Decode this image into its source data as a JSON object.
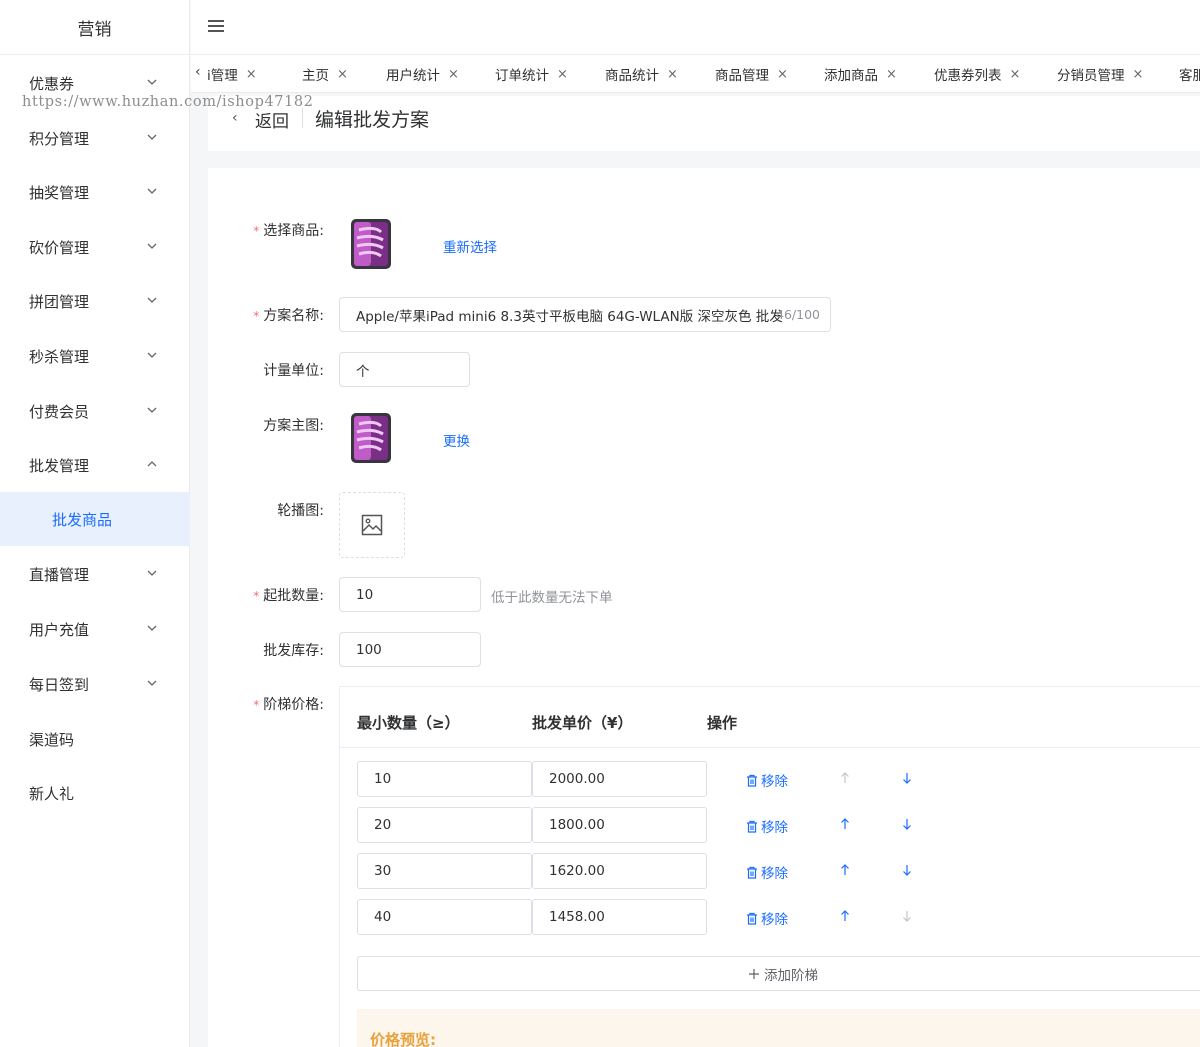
{
  "sidebar": {
    "brand": "营销",
    "items": [
      {
        "label": "优惠券",
        "chevron": "down"
      },
      {
        "label": "积分管理",
        "chevron": "down"
      },
      {
        "label": "抽奖管理",
        "chevron": "down"
      },
      {
        "label": "砍价管理",
        "chevron": "down"
      },
      {
        "label": "拼团管理",
        "chevron": "down"
      },
      {
        "label": "秒杀管理",
        "chevron": "down"
      },
      {
        "label": "付费会员",
        "chevron": "down"
      },
      {
        "label": "批发管理",
        "chevron": "up"
      },
      {
        "label": "批发商品",
        "active": true
      },
      {
        "label": "直播管理",
        "chevron": "down"
      },
      {
        "label": "用户充值",
        "chevron": "down"
      },
      {
        "label": "每日签到",
        "chevron": "down"
      },
      {
        "label": "渠道码"
      },
      {
        "label": "新人礼"
      }
    ]
  },
  "tabs": [
    {
      "label": "i管理"
    },
    {
      "label": "主页"
    },
    {
      "label": "用户统计"
    },
    {
      "label": "订单统计"
    },
    {
      "label": "商品统计"
    },
    {
      "label": "商品管理"
    },
    {
      "label": "添加商品"
    },
    {
      "label": "优惠券列表"
    },
    {
      "label": "分销员管理"
    },
    {
      "label": "客服"
    }
  ],
  "tab_close_glyph": "×",
  "watermark": "https://www.huzhan.com/ishop47182",
  "page_header": {
    "back_label": "返回",
    "title": "编辑批发方案"
  },
  "form": {
    "select_product_label": "选择商品:",
    "reselect_link": "重新选择",
    "plan_name_label": "方案名称:",
    "plan_name_value": "Apple/苹果iPad mini6 8.3英寸平板电脑 64G-WLAN版 深空灰色 批发",
    "plan_name_count": "46/100",
    "unit_label": "计量单位:",
    "unit_value": "个",
    "main_image_label": "方案主图:",
    "change_link": "更换",
    "carousel_label": "轮播图:",
    "min_qty_label": "起批数量:",
    "min_qty_value": "10",
    "min_qty_hint": "低于此数量无法下单",
    "stock_label": "批发库存:",
    "stock_value": "100",
    "tier_label": "阶梯价格:"
  },
  "tier_table": {
    "headers": {
      "min_qty": "最小数量（≥）",
      "unit_price": "批发单价（¥）",
      "actions": "操作"
    },
    "remove_label": "移除",
    "rows": [
      {
        "min_qty": "10",
        "price": "2000.00",
        "up_enabled": false,
        "down_enabled": true
      },
      {
        "min_qty": "20",
        "price": "1800.00",
        "up_enabled": true,
        "down_enabled": true
      },
      {
        "min_qty": "30",
        "price": "1620.00",
        "up_enabled": true,
        "down_enabled": true
      },
      {
        "min_qty": "40",
        "price": "1458.00",
        "up_enabled": true,
        "down_enabled": false
      }
    ],
    "add_label": "添加阶梯"
  },
  "preview": {
    "title": "价格预览:"
  },
  "colors": {
    "accent": "#1a6dff",
    "active_bg": "#e8f0fe",
    "required": "#f56c6c",
    "preview_title": "#e6a23c"
  }
}
